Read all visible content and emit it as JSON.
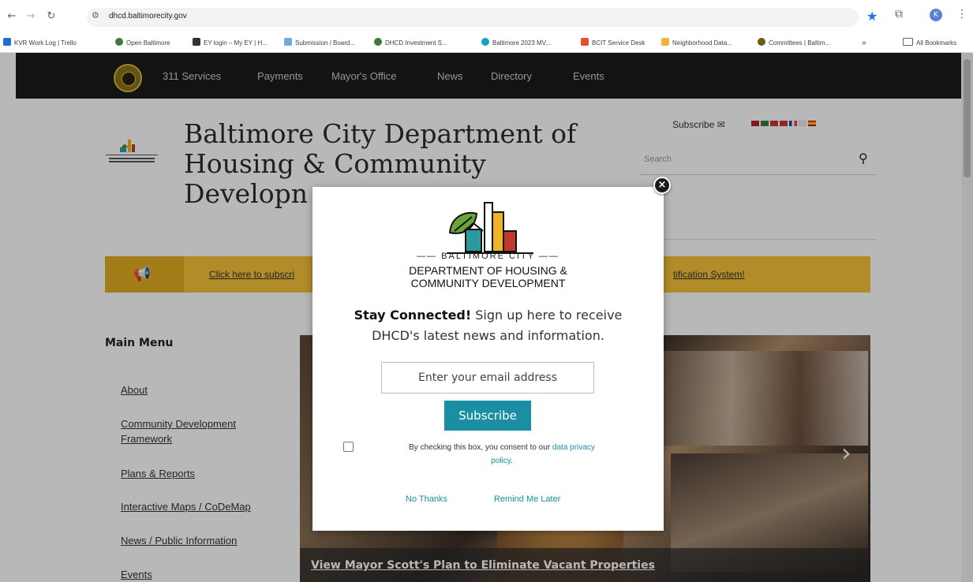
{
  "browser": {
    "url": "dhcd.baltimorecity.gov",
    "profile_initial": "K",
    "bookmarks": [
      {
        "label": "KVR Work Log | Trello",
        "color": "#1f6fd1"
      },
      {
        "label": "Open Baltimore",
        "color": "#3a7a3a"
      },
      {
        "label": "EY login – My EY | H...",
        "color": "#333333"
      },
      {
        "label": "Submission / Board...",
        "color": "#7aa7d9"
      },
      {
        "label": "DHCD Investment S...",
        "color": "#3a7a3a"
      },
      {
        "label": "Baltimore 2023 MV...",
        "color": "#1aa3b8"
      },
      {
        "label": "BCIT Service Desk",
        "color": "#e2522f"
      },
      {
        "label": "Neighborhood Data...",
        "color": "#f3b33c"
      },
      {
        "label": "Committees | Baltim...",
        "color": "#6b5a1a"
      }
    ],
    "more_bookmarks": "»",
    "all_bookmarks": "All Bookmarks"
  },
  "site": {
    "top_nav": [
      "311 Services",
      "Payments",
      "Mayor's Office",
      "News",
      "Directory",
      "Events"
    ],
    "title_line1": "Baltimore City Department of",
    "title_line2": "Housing & Community",
    "title_line3": "Developn",
    "subscribe_label": "Subscribe",
    "search_placeholder": "Search",
    "alert_left": "Click here to subscri",
    "alert_right": "tification System!",
    "main_menu_title": "Main Menu",
    "menu_items": [
      "About",
      "Community Development",
      "Framework",
      "Plans & Reports",
      "Interactive Maps / CoDeMap",
      "News / Public Information",
      "Events"
    ],
    "hero_caption": "View Mayor Scott's Plan to Eliminate Vacant Properties"
  },
  "modal": {
    "brand_top": "—— BALTIMORE CITY ——",
    "brand_line1": "DEPARTMENT OF HOUSING &",
    "brand_line2": "COMMUNITY DEVELOPMENT",
    "stay_bold": "Stay Connected!",
    "stay_rest": " Sign up here to receive",
    "stay_line2": "DHCD's latest news and information.",
    "email_placeholder": "Enter your email address",
    "subscribe_button": "Subscribe",
    "consent_prefix": "By checking this box, you consent to our ",
    "consent_link": "data privacy",
    "consent_link2": "policy",
    "consent_suffix": ".",
    "no_thanks": "No Thanks",
    "remind_later": "Remind Me Later",
    "close": "×"
  },
  "colors": {
    "accent_teal": "#1a8fa3",
    "alert_yellow": "#f6c33a",
    "topbar_dark": "#1b1b1b"
  }
}
